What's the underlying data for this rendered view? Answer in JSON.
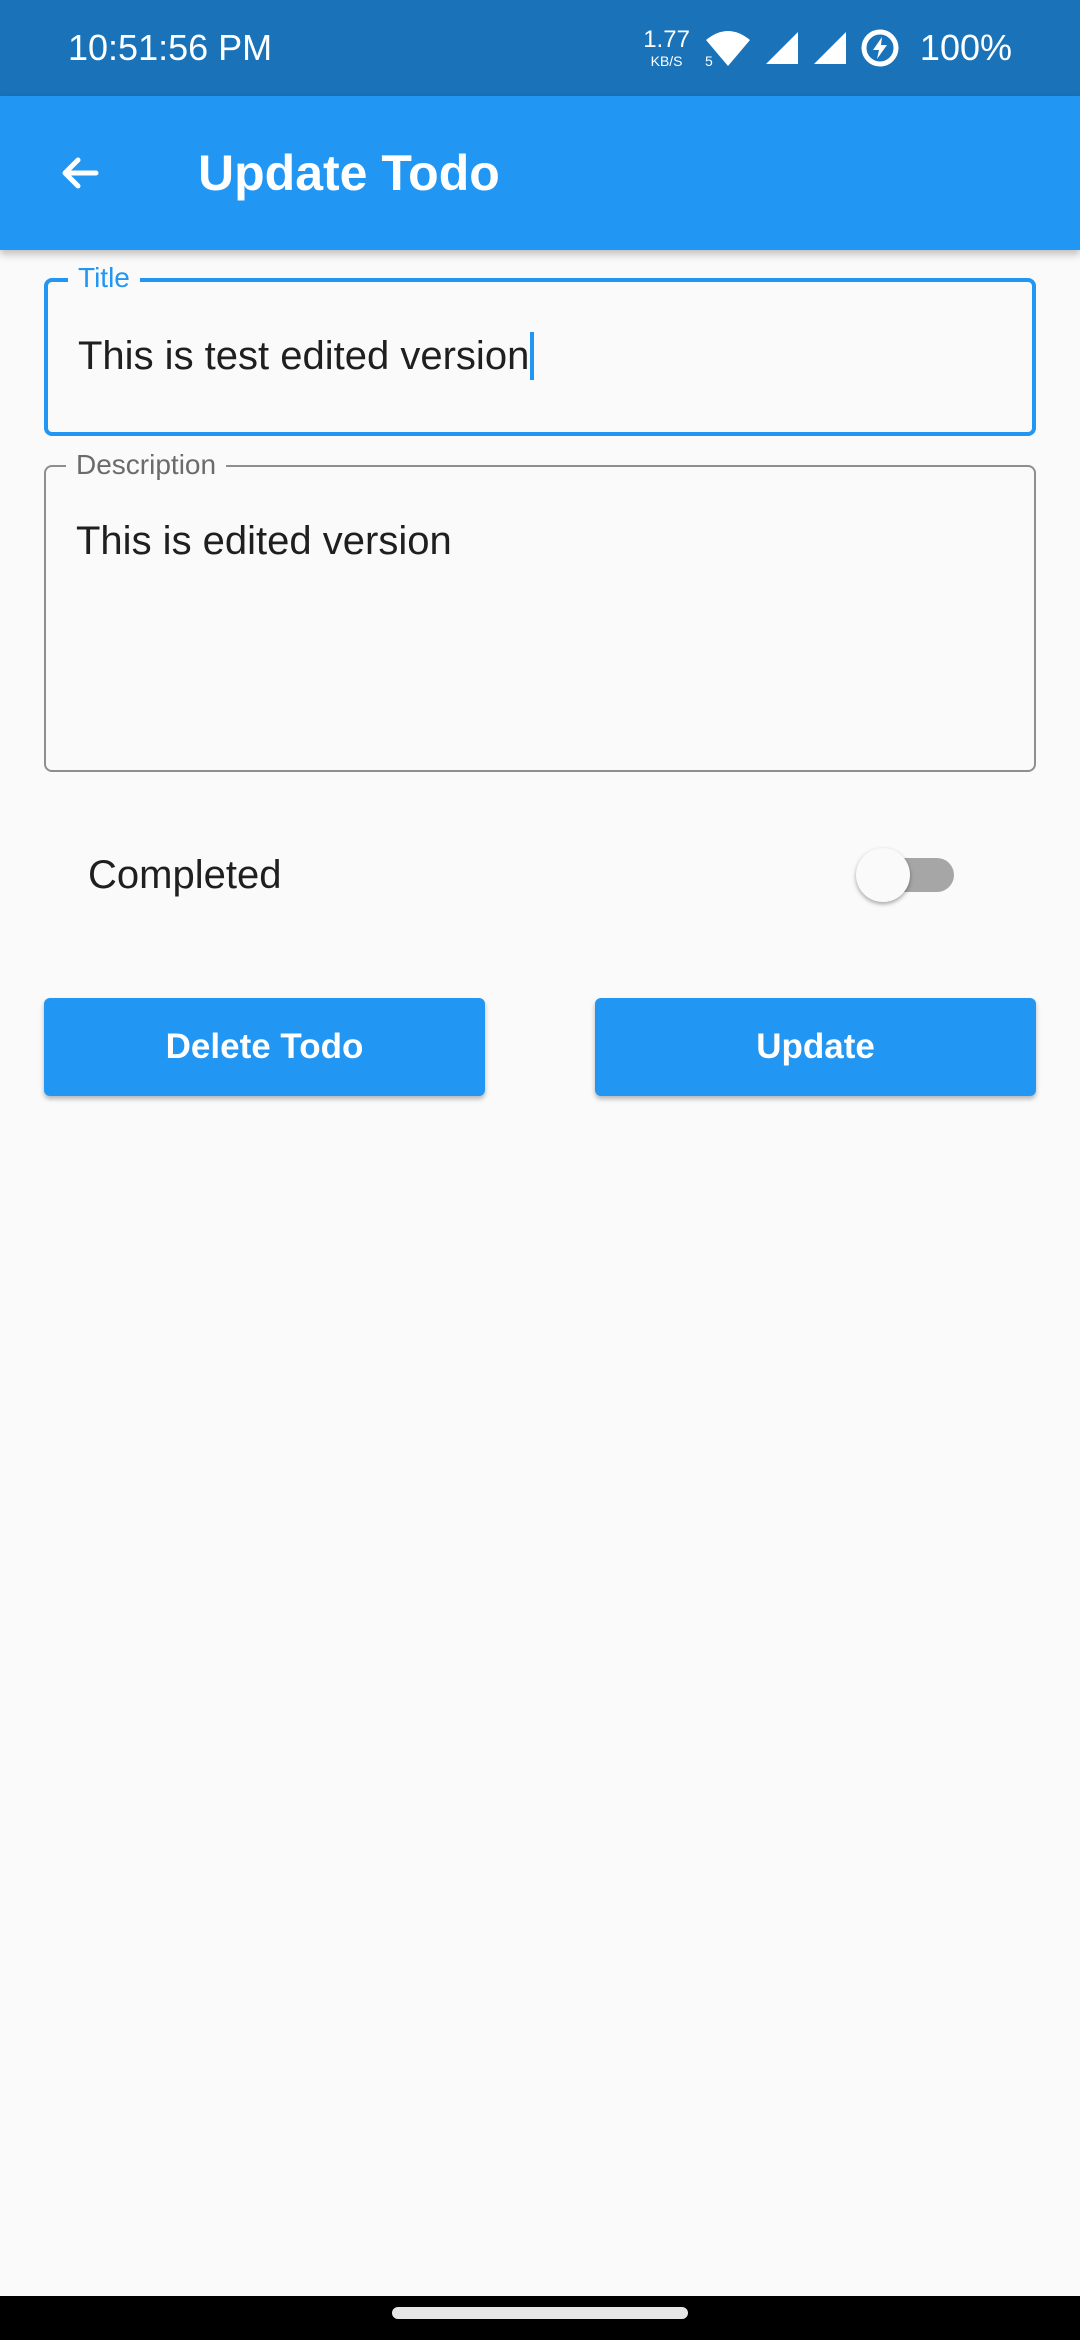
{
  "status_bar": {
    "time": "10:51:56 PM",
    "net_speed_value": "1.77",
    "net_speed_unit": "KB/S",
    "wifi_badge": "5",
    "battery_percent": "100%",
    "icons": [
      "wifi-icon",
      "signal-icon",
      "signal-icon",
      "battery-saver-icon"
    ]
  },
  "app_bar": {
    "title": "Update Todo",
    "back_icon": "arrow-back-icon",
    "background": "#2196f3"
  },
  "form": {
    "title_field": {
      "label": "Title",
      "value": "This is test edited version",
      "focused": true
    },
    "description_field": {
      "label": "Description",
      "value": "This is edited version"
    },
    "completed": {
      "label": "Completed",
      "checked": false
    }
  },
  "actions": {
    "delete_label": "Delete Todo",
    "update_label": "Update"
  },
  "colors": {
    "accent": "#2196f3",
    "status_bar": "#1a73b8",
    "background": "#fafafa"
  }
}
